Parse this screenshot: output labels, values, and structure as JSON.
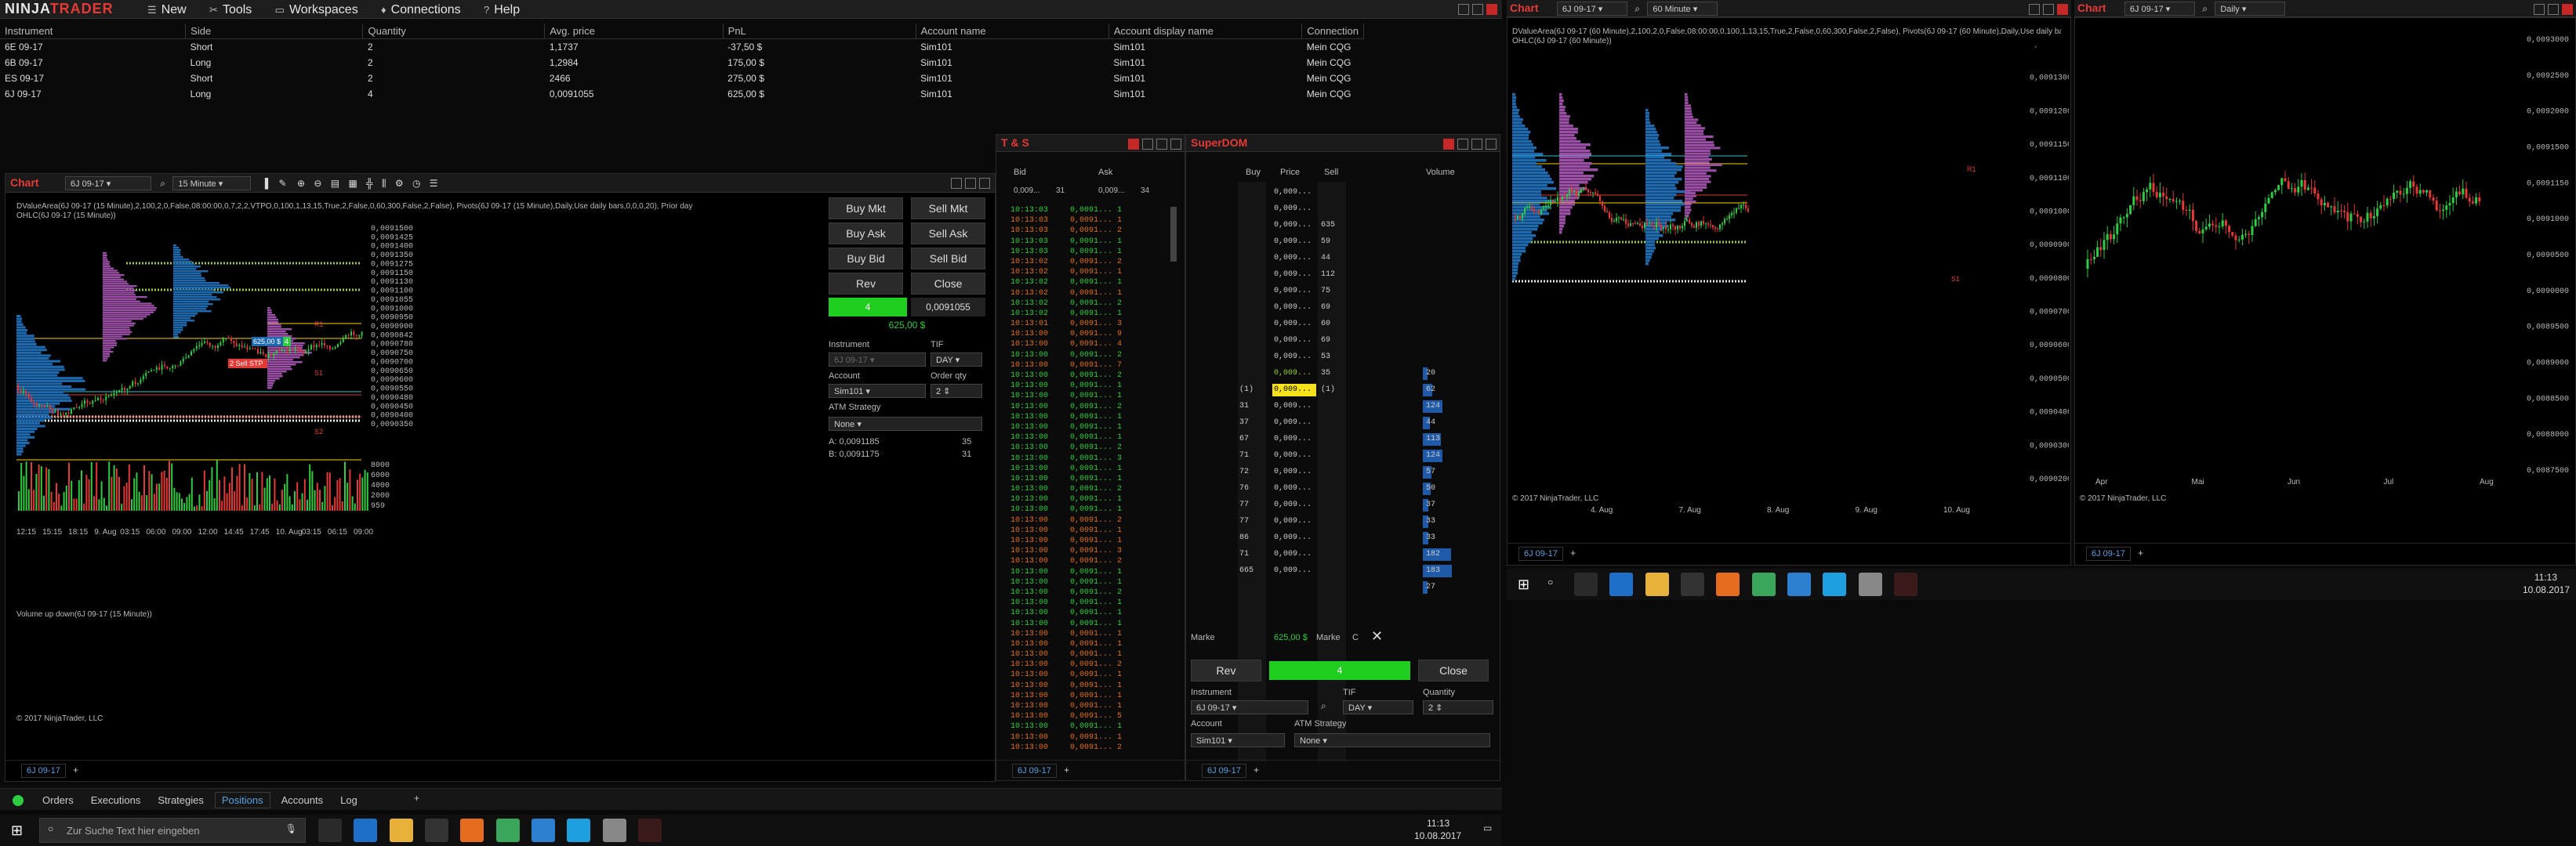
{
  "app": {
    "logo": "NINJATRADER",
    "menu": [
      "New",
      "Tools",
      "Workspaces",
      "Connections",
      "Help"
    ]
  },
  "positions": {
    "columns": [
      "Instrument",
      "Side",
      "Quantity",
      "Avg. price",
      "PnL",
      "Account name",
      "Account display name",
      "Connection"
    ],
    "rows": [
      {
        "instrument": "6E 09-17",
        "side": "Short",
        "qty": "2",
        "avg": "1,1737",
        "pnl": "-37,50 $",
        "pnl_color": "red",
        "acct": "Sim101",
        "disp": "Sim101",
        "conn": "Mein CQG"
      },
      {
        "instrument": "6B 09-17",
        "side": "Long",
        "qty": "2",
        "avg": "1,2984",
        "pnl": "175,00 $",
        "pnl_color": "green",
        "acct": "Sim101",
        "disp": "Sim101",
        "conn": "Mein CQG"
      },
      {
        "instrument": "ES 09-17",
        "side": "Short",
        "qty": "2",
        "avg": "2466",
        "pnl": "275,00 $",
        "pnl_color": "green",
        "acct": "Sim101",
        "disp": "Sim101",
        "conn": "Mein CQG"
      },
      {
        "instrument": "6J 09-17",
        "side": "Long",
        "qty": "4",
        "avg": "0,0091055",
        "pnl": "625,00 $",
        "pnl_color": "green",
        "acct": "Sim101",
        "disp": "Sim101",
        "conn": "Mein CQG"
      }
    ]
  },
  "chart_left": {
    "title": "Chart",
    "instrument": "6J 09-17",
    "interval": "15 Minute",
    "indicator_line1": "DValueArea(6J 09-17 (15 Minute),2,100,2,0,False,08:00:00,0,7,2,2,VTPO,0,100,1,13,15,True,2,False,0,60,300,False,2,False), Pivots(6J 09-17 (15 Minute),Daily,Use daily bars,0,0,0,20), Prior day",
    "indicator_line2": "OHLC(6J 09-17 (15 Minute))",
    "volume_label": "Volume up down(6J 09-17 (15 Minute))",
    "copyright": "© 2017 NinjaTrader, LLC",
    "y_ticks": [
      "0,0091500",
      "0,0091425",
      "0,0091400",
      "0,0091350",
      "0,0091275",
      "0,0091150",
      "0,0091130",
      "0,0091100",
      "0,0091055",
      "0,0091000",
      "0,0090950",
      "0,0090900",
      "0,0090842",
      "0,0090780",
      "0,0090750",
      "0,0090700",
      "0,0090650",
      "0,0090600",
      "0,0090550",
      "0,0090480",
      "0,0090450",
      "0,0090400",
      "0,0090350"
    ],
    "vol_ticks": [
      "8000",
      "6000",
      "4000",
      "2000",
      "959"
    ],
    "x_ticks": [
      "12:15",
      "15:15",
      "18:15",
      "9. Aug",
      "03:15",
      "06:00",
      "09:00",
      "12:00",
      "14:45",
      "17:45",
      "10. Aug",
      "03:15",
      "06:15",
      "09:00"
    ],
    "tab": "6J 09-17",
    "order_tag_1": "625,00 $",
    "order_tag_qty": "4",
    "sell_stp": "2  Sell STP",
    "labels": [
      "S1",
      "S2",
      "R1"
    ]
  },
  "order_panel": {
    "buy_mkt": "Buy Mkt",
    "sell_mkt": "Sell Mkt",
    "buy_ask": "Buy Ask",
    "sell_ask": "Sell Ask",
    "buy_bid": "Buy Bid",
    "sell_bid": "Sell Bid",
    "rev": "Rev",
    "close": "Close",
    "position_qty": "4",
    "position_price": "0,0091055",
    "pnl": "625,00 $",
    "instrument_label": "Instrument",
    "tif_label": "TIF",
    "instrument": "6J 09-17",
    "tif": "DAY",
    "account_label": "Account",
    "orderqty_label": "Order qty",
    "account": "Sim101",
    "order_qty": "2",
    "atm_label": "ATM Strategy",
    "atm": "None",
    "ask_line": "A: 0,0091185",
    "ask_size": "35",
    "bid_line": "B: 0,0091175",
    "bid_size": "31"
  },
  "ts": {
    "title": "T & S",
    "bid_label": "Bid",
    "ask_label": "Ask",
    "bid_val": "0,009...",
    "bid_size": "31",
    "ask_val": "0,009...",
    "ask_size": "34",
    "rows": [
      {
        "t": "10:13:03",
        "p": "0,0091...",
        "s": "1",
        "c": "g"
      },
      {
        "t": "10:13:03",
        "p": "0,0091...",
        "s": "1",
        "c": "r"
      },
      {
        "t": "10:13:03",
        "p": "0,0091...",
        "s": "2",
        "c": "r"
      },
      {
        "t": "10:13:03",
        "p": "0,0091...",
        "s": "1",
        "c": "g"
      },
      {
        "t": "10:13:03",
        "p": "0,0091...",
        "s": "1",
        "c": "g"
      },
      {
        "t": "10:13:02",
        "p": "0,0091...",
        "s": "2",
        "c": "r"
      },
      {
        "t": "10:13:02",
        "p": "0,0091...",
        "s": "1",
        "c": "r"
      },
      {
        "t": "10:13:02",
        "p": "0,0091...",
        "s": "1",
        "c": "g"
      },
      {
        "t": "10:13:02",
        "p": "0,0091...",
        "s": "1",
        "c": "r"
      },
      {
        "t": "10:13:02",
        "p": "0,0091...",
        "s": "2",
        "c": "g"
      },
      {
        "t": "10:13:02",
        "p": "0,0091...",
        "s": "1",
        "c": "g"
      },
      {
        "t": "10:13:01",
        "p": "0,0091...",
        "s": "3",
        "c": "r"
      },
      {
        "t": "10:13:00",
        "p": "0,0091...",
        "s": "9",
        "c": "r"
      },
      {
        "t": "10:13:00",
        "p": "0,0091...",
        "s": "4",
        "c": "r"
      },
      {
        "t": "10:13:00",
        "p": "0,0091...",
        "s": "2",
        "c": "g"
      },
      {
        "t": "10:13:00",
        "p": "0,0091...",
        "s": "7",
        "c": "r"
      },
      {
        "t": "10:13:00",
        "p": "0,0091...",
        "s": "2",
        "c": "g"
      },
      {
        "t": "10:13:00",
        "p": "0,0091...",
        "s": "1",
        "c": "g"
      },
      {
        "t": "10:13:00",
        "p": "0,0091...",
        "s": "1",
        "c": "g"
      },
      {
        "t": "10:13:00",
        "p": "0,0091...",
        "s": "2",
        "c": "g"
      },
      {
        "t": "10:13:00",
        "p": "0,0091...",
        "s": "1",
        "c": "g"
      },
      {
        "t": "10:13:00",
        "p": "0,0091...",
        "s": "1",
        "c": "g"
      },
      {
        "t": "10:13:00",
        "p": "0,0091...",
        "s": "1",
        "c": "g"
      },
      {
        "t": "10:13:00",
        "p": "0,0091...",
        "s": "2",
        "c": "g"
      },
      {
        "t": "10:13:00",
        "p": "0,0091...",
        "s": "3",
        "c": "g"
      },
      {
        "t": "10:13:00",
        "p": "0,0091...",
        "s": "1",
        "c": "g"
      },
      {
        "t": "10:13:00",
        "p": "0,0091...",
        "s": "1",
        "c": "g"
      },
      {
        "t": "10:13:00",
        "p": "0,0091...",
        "s": "2",
        "c": "g"
      },
      {
        "t": "10:13:00",
        "p": "0,0091...",
        "s": "1",
        "c": "g"
      },
      {
        "t": "10:13:00",
        "p": "0,0091...",
        "s": "1",
        "c": "g"
      },
      {
        "t": "10:13:00",
        "p": "0,0091...",
        "s": "2",
        "c": "r"
      },
      {
        "t": "10:13:00",
        "p": "0,0091...",
        "s": "1",
        "c": "r"
      },
      {
        "t": "10:13:00",
        "p": "0,0091...",
        "s": "1",
        "c": "r"
      },
      {
        "t": "10:13:00",
        "p": "0,0091...",
        "s": "3",
        "c": "r"
      },
      {
        "t": "10:13:00",
        "p": "0,0091...",
        "s": "2",
        "c": "r"
      },
      {
        "t": "10:13:00",
        "p": "0,0091...",
        "s": "1",
        "c": "g"
      },
      {
        "t": "10:13:00",
        "p": "0,0091...",
        "s": "1",
        "c": "g"
      },
      {
        "t": "10:13:00",
        "p": "0,0091...",
        "s": "2",
        "c": "g"
      },
      {
        "t": "10:13:00",
        "p": "0,0091...",
        "s": "1",
        "c": "g"
      },
      {
        "t": "10:13:00",
        "p": "0,0091...",
        "s": "1",
        "c": "g"
      },
      {
        "t": "10:13:00",
        "p": "0,0091...",
        "s": "1",
        "c": "g"
      },
      {
        "t": "10:13:00",
        "p": "0,0091...",
        "s": "1",
        "c": "r"
      },
      {
        "t": "10:13:00",
        "p": "0,0091...",
        "s": "1",
        "c": "r"
      },
      {
        "t": "10:13:00",
        "p": "0,0091...",
        "s": "1",
        "c": "r"
      },
      {
        "t": "10:13:00",
        "p": "0,0091...",
        "s": "2",
        "c": "r"
      },
      {
        "t": "10:13:00",
        "p": "0,0091...",
        "s": "1",
        "c": "r"
      },
      {
        "t": "10:13:00",
        "p": "0,0091...",
        "s": "1",
        "c": "r"
      },
      {
        "t": "10:13:00",
        "p": "0,0091...",
        "s": "1",
        "c": "r"
      },
      {
        "t": "10:13:00",
        "p": "0,0091...",
        "s": "1",
        "c": "r"
      },
      {
        "t": "10:13:00",
        "p": "0,0091...",
        "s": "5",
        "c": "r"
      },
      {
        "t": "10:13:00",
        "p": "0,0091...",
        "s": "1",
        "c": "g"
      },
      {
        "t": "10:13:00",
        "p": "0,0091...",
        "s": "1",
        "c": "r"
      },
      {
        "t": "10:13:00",
        "p": "0,0091...",
        "s": "2",
        "c": "r"
      },
      {
        "t": "10:12:59",
        "p": "0,0091...",
        "s": "1",
        "c": "r"
      }
    ],
    "tab": "6J 09-17"
  },
  "dom": {
    "title": "SuperDOM",
    "buy_label": "Buy",
    "price_label": "Price",
    "sell_label": "Sell",
    "volume_label": "Volume",
    "rows": [
      {
        "buy": "",
        "price": "0,009...",
        "sell": "",
        "vol": "",
        "hl": ""
      },
      {
        "buy": "",
        "price": "0,009...",
        "sell": "",
        "vol": "",
        "hl": ""
      },
      {
        "buy": "",
        "price": "0,009...",
        "sell": "635",
        "vol": "",
        "hl": ""
      },
      {
        "buy": "",
        "price": "0,009...",
        "sell": "59",
        "vol": "",
        "hl": ""
      },
      {
        "buy": "",
        "price": "0,009...",
        "sell": "44",
        "vol": "",
        "hl": ""
      },
      {
        "buy": "",
        "price": "0,009...",
        "sell": "112",
        "vol": "",
        "hl": ""
      },
      {
        "buy": "",
        "price": "0,009...",
        "sell": "75",
        "vol": "",
        "hl": ""
      },
      {
        "buy": "",
        "price": "0,009...",
        "sell": "69",
        "vol": "",
        "hl": ""
      },
      {
        "buy": "",
        "price": "0,009...",
        "sell": "60",
        "vol": "",
        "hl": ""
      },
      {
        "buy": "",
        "price": "0,009...",
        "sell": "69",
        "vol": "",
        "hl": ""
      },
      {
        "buy": "",
        "price": "0,009...",
        "sell": "53",
        "vol": "",
        "hl": ""
      },
      {
        "buy": "",
        "price": "0,009...",
        "sell": "35",
        "vol": "20",
        "hl": "g"
      },
      {
        "buy": "(1)",
        "price": "0,009...",
        "sell": "(1)",
        "vol": "62",
        "hl": "y"
      },
      {
        "buy": "31",
        "price": "0,009...",
        "sell": "",
        "vol": "124",
        "hl": ""
      },
      {
        "buy": "37",
        "price": "0,009...",
        "sell": "",
        "vol": "44",
        "hl": ""
      },
      {
        "buy": "67",
        "price": "0,009...",
        "sell": "",
        "vol": "113",
        "hl": ""
      },
      {
        "buy": "71",
        "price": "0,009...",
        "sell": "",
        "vol": "124",
        "hl": ""
      },
      {
        "buy": "72",
        "price": "0,009...",
        "sell": "",
        "vol": "57",
        "hl": ""
      },
      {
        "buy": "76",
        "price": "0,009...",
        "sell": "",
        "vol": "50",
        "hl": ""
      },
      {
        "buy": "77",
        "price": "0,009...",
        "sell": "",
        "vol": "37",
        "hl": ""
      },
      {
        "buy": "77",
        "price": "0,009...",
        "sell": "",
        "vol": "33",
        "hl": ""
      },
      {
        "buy": "86",
        "price": "0,009...",
        "sell": "",
        "vol": "33",
        "hl": ""
      },
      {
        "buy": "71",
        "price": "0,009...",
        "sell": "",
        "vol": "182",
        "hl": ""
      },
      {
        "buy": "665",
        "price": "0,009...",
        "sell": "",
        "vol": "183",
        "hl": ""
      },
      {
        "buy": "",
        "price": "",
        "sell": "",
        "vol": "27",
        "hl": ""
      }
    ],
    "market_left": "Marke",
    "pnl": "625,00 $",
    "market_right": "Marke",
    "c_label": "C",
    "rev": "Rev",
    "position_qty": "4",
    "close": "Close",
    "instrument_label": "Instrument",
    "tif_label": "TIF",
    "quantity_label": "Quantity",
    "instrument": "6J 09-17",
    "tif": "DAY",
    "quantity": "2",
    "account_label": "Account",
    "atm_label": "ATM Strategy",
    "account": "Sim101",
    "atm": "None",
    "tab": "6J 09-17"
  },
  "chart_mid": {
    "title": "Chart",
    "instrument": "6J 09-17",
    "interval": "60 Minute",
    "indicator_line1": "DValueArea(6J 09-17 (60 Minute),2,100,2,0,False,08:00:00,0,100,1,13,15,True,2,False,0,60,300,False,2,False), Pivots(6J 09-17 (60 Minute),Daily,Use daily bars,0,0,0,20), Prior day",
    "indicator_line2": "OHLC(6J 09-17 (60 Minute))",
    "copyright": "© 2017 NinjaTrader, LLC",
    "y_ticks": [
      "0,0091400",
      "0,0091300",
      "0,0091200",
      "0,0091150",
      "0,0091100",
      "0,0091000",
      "0,0090900",
      "0,0090800",
      "0,0090700",
      "0,0090600",
      "0,0090500",
      "0,0090400",
      "0,0090300",
      "0,0090200"
    ],
    "x_ticks": [
      "4. Aug",
      "7. Aug",
      "8. Aug",
      "9. Aug",
      "10. Aug"
    ],
    "tab": "6J 09-17",
    "labels": [
      "S1",
      "R1"
    ]
  },
  "chart_right": {
    "title": "Chart",
    "instrument": "6J 09-17",
    "interval": "Daily",
    "copyright": "© 2017 NinjaTrader, LLC",
    "y_ticks": [
      "0,0093000",
      "0,0092500",
      "0,0092000",
      "0,0091500",
      "0,0091150",
      "0,0091000",
      "0,0090500",
      "0,0090000",
      "0,0089500",
      "0,0089000",
      "0,0088500",
      "0,0088000",
      "0,0087500"
    ],
    "x_ticks": [
      "Apr",
      "Mai",
      "Jun",
      "Jul",
      "Aug"
    ],
    "tab": "6J 09-17"
  },
  "bottom_tabs": [
    "Orders",
    "Executions",
    "Strategies",
    "Positions",
    "Accounts",
    "Log"
  ],
  "taskbar": {
    "search_placeholder": "Zur Suche Text hier eingeben",
    "time": "11:13",
    "date": "10.08.2017"
  },
  "taskbar2": {
    "time": "11:13",
    "date": "10.08.2017"
  }
}
